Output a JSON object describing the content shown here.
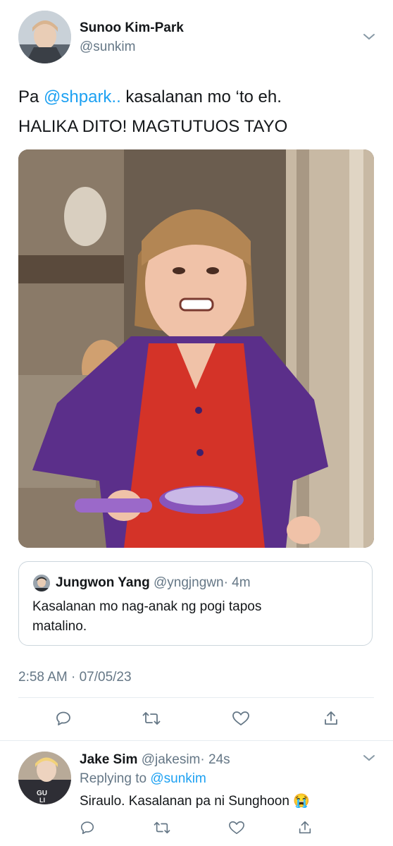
{
  "tweet": {
    "author_name": "Sunoo Kim-Park",
    "handle": "@sunkim",
    "text_prefix": "Pa ",
    "mention": "@shpark..",
    "text_line1_rest": " kasalanan mo ‘to eh.",
    "text_line2": "HALIKA DITO! MAGTUTUOS TAYO",
    "timestamp": "2:58 AM · 07/05/23"
  },
  "quoted": {
    "author_name": "Jungwon Yang",
    "handle": "@yngjngwn",
    "time": "· 4m",
    "text_line1": "Kasalanan mo nag-anak ng pogi tapos",
    "text_line2": "matalino."
  },
  "reply": {
    "author_name": "Jake Sim",
    "handle": "@jakesim",
    "time": "· 24s",
    "replying_label": "Replying to",
    "replying_to": "@sunkim",
    "text": "Siraulo. Kasalanan pa ni Sunghoon",
    "emoji": "😭",
    "avatar_text": "GU LI"
  },
  "icons": {
    "reply": "reply-icon",
    "retweet": "retweet-icon",
    "like": "heart-icon",
    "share": "share-icon",
    "menu": "chevron-down-icon"
  },
  "colors": {
    "accent": "#1da1f2",
    "secondary_text": "#657786",
    "divider": "#e6ecf0"
  }
}
